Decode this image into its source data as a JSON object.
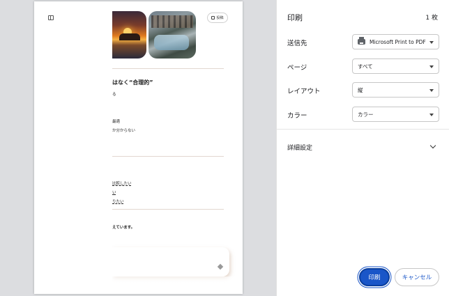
{
  "preview": {
    "share_label": "投稿",
    "heading": "はなく“合理的”",
    "lines": {
      "l1": "る",
      "l2": "最適",
      "l3": "か分からない",
      "l4": "比較したい",
      "l5": "い",
      "l6": "りたい",
      "l7": "えています。"
    }
  },
  "panel": {
    "title": "印刷",
    "sheet_count": "1 枚",
    "destination": {
      "label": "送信先",
      "value": "Microsoft Print to PDF"
    },
    "pages": {
      "label": "ページ",
      "value": "すべて"
    },
    "layout": {
      "label": "レイアウト",
      "value": "縦"
    },
    "color": {
      "label": "カラー",
      "value": "カラー"
    },
    "more_settings": "詳細設定",
    "print_button": "印刷",
    "cancel_button": "キャンセル"
  },
  "colors": {
    "accent": "#1a56c8",
    "background": "#dcdde0"
  },
  "icons": {
    "panel_toggle": "sidebar-toggle-icon",
    "share": "share-icon",
    "printer": "printer-icon",
    "expand": "chevron-down-icon"
  }
}
